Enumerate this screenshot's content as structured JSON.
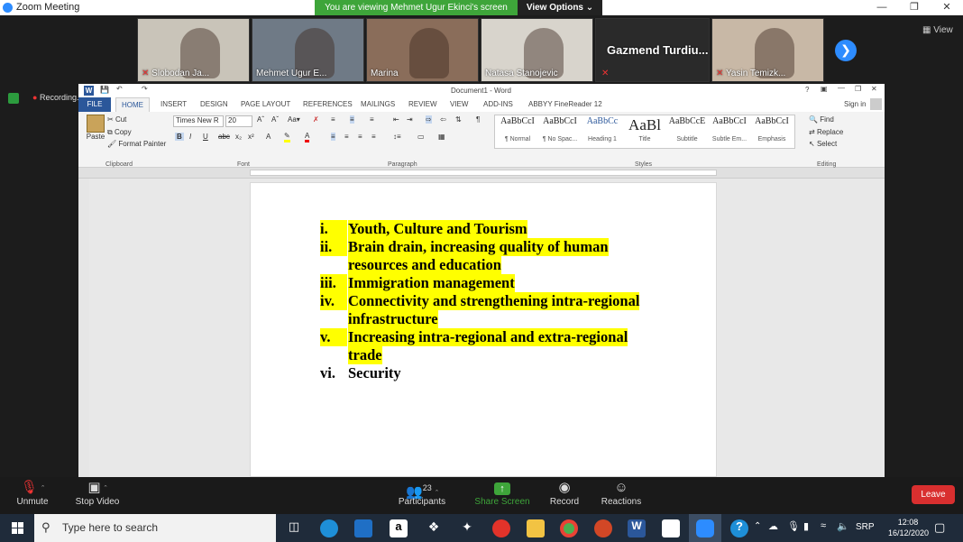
{
  "window": {
    "title": "Zoom Meeting"
  },
  "share_banner": {
    "text": "You are viewing Mehmet Ugur Ekinci's screen",
    "view_options": "View Options"
  },
  "participants": [
    {
      "name": "Slobodan Ja...",
      "muted": true,
      "bg": "#c9c4b9"
    },
    {
      "name": "Mehmet Ugur E...",
      "muted": false,
      "bg": "#6f7a86"
    },
    {
      "name": "Marina",
      "muted": false,
      "bg": "#8a6d5a"
    },
    {
      "name": "Natasa Stanojevic",
      "muted": false,
      "bg": "#d8d4cc"
    },
    {
      "name": "Gazmend Turdiu...",
      "muted": true,
      "bg": "#2a2a2a"
    },
    {
      "name": "Yasin Temizk...",
      "muted": true,
      "bg": "#c8b8a6"
    }
  ],
  "grid_view_label": "View",
  "recording_label": "Recording...",
  "word": {
    "title": "Document1 - Word",
    "sign_in": "Sign in",
    "tabs": [
      "FILE",
      "HOME",
      "INSERT",
      "DESIGN",
      "PAGE LAYOUT",
      "REFERENCES",
      "MAILINGS",
      "REVIEW",
      "VIEW",
      "ADD-INS",
      "ABBYY FineReader 12"
    ],
    "clipboard": {
      "paste": "Paste",
      "cut": "Cut",
      "copy": "Copy",
      "format_painter": "Format Painter",
      "group": "Clipboard"
    },
    "font": {
      "name": "Times New R",
      "size": "20",
      "group": "Font"
    },
    "paragraph_group": "Paragraph",
    "styles": [
      {
        "sample": "AaBbCcI",
        "label": "¶ Normal"
      },
      {
        "sample": "AaBbCcI",
        "label": "¶ No Spac..."
      },
      {
        "sample": "AaBbCc",
        "label": "Heading 1"
      },
      {
        "sample": "AaBl",
        "label": "Title"
      },
      {
        "sample": "AaBbCcE",
        "label": "Subtitle"
      },
      {
        "sample": "AaBbCcI",
        "label": "Subtle Em..."
      },
      {
        "sample": "AaBbCcI",
        "label": "Emphasis"
      }
    ],
    "styles_group": "Styles",
    "editing": {
      "find": "Find",
      "replace": "Replace",
      "select": "Select",
      "group": "Editing"
    }
  },
  "document": {
    "items": [
      {
        "num": "i.",
        "lines": [
          "Youth, Culture and Tourism"
        ],
        "highlight": true
      },
      {
        "num": "ii.",
        "lines": [
          "Brain drain, increasing quality of human",
          "resources and education"
        ],
        "highlight": true
      },
      {
        "num": "iii.",
        "lines": [
          "Immigration management"
        ],
        "highlight": true
      },
      {
        "num": "iv.",
        "lines": [
          "Connectivity and strengthening intra-regional",
          "infrastructure"
        ],
        "highlight": true
      },
      {
        "num": "v.",
        "lines": [
          "Increasing intra-regional and extra-regional",
          "trade"
        ],
        "highlight": true
      },
      {
        "num": "vi.",
        "lines": [
          "Security"
        ],
        "highlight": false
      }
    ]
  },
  "controls": {
    "unmute": "Unmute",
    "stop_video": "Stop Video",
    "participants": "Participants",
    "participant_count": "23",
    "share_screen": "Share Screen",
    "record": "Record",
    "reactions": "Reactions",
    "leave": "Leave"
  },
  "taskbar": {
    "search_placeholder": "Type here to search",
    "language": "SRP",
    "time": "12:08",
    "date": "16/12/2020"
  },
  "colors": {
    "zoom_blue": "#2d8cff",
    "share_green": "#3ea53a",
    "word_blue": "#2b579a",
    "highlight": "#ffff00",
    "leave_red": "#d92f2f"
  }
}
